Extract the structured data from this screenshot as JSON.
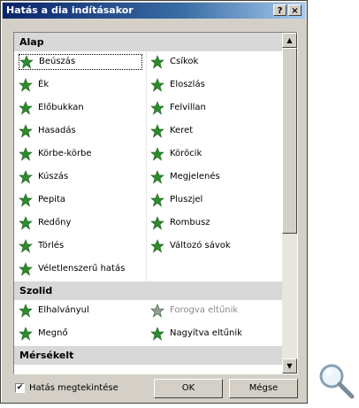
{
  "window": {
    "title": "Hatás a dia indításakor",
    "help_label": "?",
    "close_label": "×"
  },
  "effects": {
    "alap": {
      "header": "Alap",
      "rows": [
        [
          "Beúszás",
          "Csíkok"
        ],
        [
          "Ék",
          "Eloszlás"
        ],
        [
          "Előbukkan",
          "Felvillan"
        ],
        [
          "Hasadás",
          "Keret"
        ],
        [
          "Körbe-körbe",
          "Köröcik"
        ],
        [
          "Kúszás",
          "Megjelenés"
        ],
        [
          "Pepita",
          "Pluszjel"
        ],
        [
          "Redőny",
          "Rombusz"
        ],
        [
          "Törlés",
          "Változó sávok"
        ],
        [
          "Véletlenszerű hatás",
          ""
        ]
      ]
    },
    "szolid": {
      "header": "Szolid",
      "rows": [
        [
          "Elhalványul",
          "Forogva eltűnik"
        ],
        [
          "Megnő",
          "Nagyítva eltűnik"
        ]
      ]
    },
    "mersekelt": {
      "header": "Mérsékelt"
    },
    "selected_item": "Beúszás",
    "disabled_items": [
      "Forogva eltűnik"
    ]
  },
  "bottom": {
    "preview_label": "Hatás megtekintése",
    "preview_checked": true,
    "ok_label": "OK",
    "cancel_label": "Mégse"
  },
  "colors": {
    "icon_green": "#2e8b2e",
    "icon_gray": "#9a9a9a",
    "title_bar": "#0a246a"
  }
}
